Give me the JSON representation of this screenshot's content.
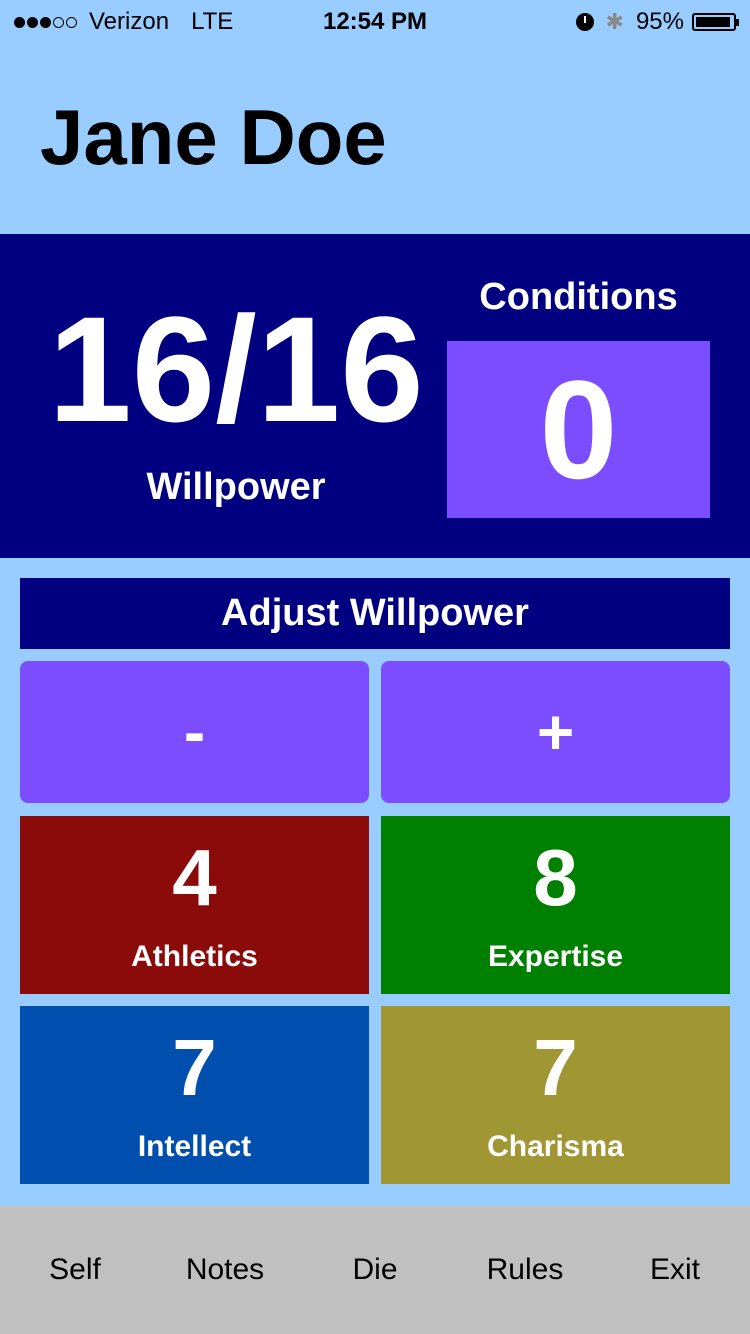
{
  "status_bar": {
    "carrier": "Verizon",
    "network": "LTE",
    "time": "12:54 PM",
    "battery_percent": "95%",
    "signal_bars_filled": 3,
    "signal_bars_total": 5,
    "battery_level": 0.95
  },
  "character": {
    "name": "Jane Doe"
  },
  "willpower": {
    "value": "16/16",
    "label": "Willpower"
  },
  "conditions": {
    "label": "Conditions",
    "value": "0"
  },
  "adjust": {
    "title": "Adjust Willpower",
    "minus": "-",
    "plus": "+"
  },
  "attributes": [
    {
      "value": "4",
      "label": "Athletics",
      "color": "#8b0a0a"
    },
    {
      "value": "8",
      "label": "Expertise",
      "color": "#008000"
    },
    {
      "value": "7",
      "label": "Intellect",
      "color": "#004faf"
    },
    {
      "value": "7",
      "label": "Charisma",
      "color": "#a09634"
    }
  ],
  "tabs": [
    "Self",
    "Notes",
    "Die",
    "Rules",
    "Exit"
  ],
  "colors": {
    "background": "#99ccff",
    "panel": "#000080",
    "accent": "#7b4dff",
    "tab_bar": "#c0c0c0"
  },
  "icons": [
    "alarm-icon",
    "bluetooth-icon",
    "battery-icon"
  ]
}
